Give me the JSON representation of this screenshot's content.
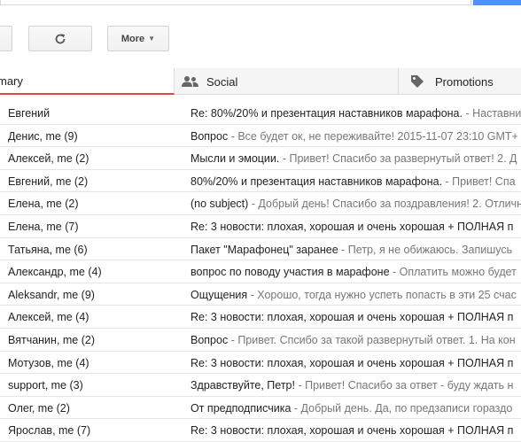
{
  "toolbar": {
    "more_label": "More",
    "caret": "▼",
    "refresh_icon": "refresh-icon"
  },
  "tabs": [
    {
      "label": "mary",
      "icon": "inbox-icon"
    },
    {
      "label": "Social",
      "icon": "people-icon"
    },
    {
      "label": "Promotions",
      "icon": "tag-icon"
    }
  ],
  "colors": {
    "primary_tab_underline": "#dd4b39",
    "search_button": "#4d90fe",
    "snippet_text": "#777777"
  },
  "emails": [
    {
      "sender": "Евгений",
      "subject": "Re: 80%/20% и презентация наставников марафона.",
      "snippet": " - Наставники марафона"
    },
    {
      "sender": "Денис, me (9)",
      "subject": "Вопрос",
      "snippet": " - Все будет ок, не переживайте! 2015-11-07 23:10 GMT+"
    },
    {
      "sender": "Алексей, me (2)",
      "subject": "Мысли и эмоции.",
      "snippet": " - Привет! Спасибо за развернутый ответ! 2. Д"
    },
    {
      "sender": "Евгений, me (2)",
      "subject": "80%/20% и презентация наставников марафона.",
      "snippet": " - Привет! Спа"
    },
    {
      "sender": "Елена, me (2)",
      "subject": "(no subject)",
      "snippet": " - Добрый день! Спасибо за поздравления! 2. Отличн"
    },
    {
      "sender": "Елена, me (7)",
      "subject": "Re: 3 новости: плохая, хорошая и очень хорошая + ПОЛНАЯ п",
      "snippet": ""
    },
    {
      "sender": "Татьяна, me (6)",
      "subject": "Пакет \"Марафонец\" заранее",
      "snippet": " - Петр, я не обижаюсь. Запишусь"
    },
    {
      "sender": "Александр, me (4)",
      "subject": "вопрос по поводу участия в марафоне",
      "snippet": " - Оплатить можно будет"
    },
    {
      "sender": "Aleksandr, me (9)",
      "subject": "Ощущения",
      "snippet": " - Хорошо, тогда нужно успеть попасть в эти 25 счас"
    },
    {
      "sender": "Алексей, me (4)",
      "subject": "Re: 3 новости: плохая, хорошая и очень хорошая + ПОЛНАЯ п",
      "snippet": ""
    },
    {
      "sender": "Вятчанин, me (2)",
      "subject": "Вопрос",
      "snippet": " - Привет. Спсибо за такой развернутый ответ. 1. На кон"
    },
    {
      "sender": "Мотузов, me (4)",
      "subject": "Re: 3 новости: плохая, хорошая и очень хорошая + ПОЛНАЯ п",
      "snippet": ""
    },
    {
      "sender": "support, me (3)",
      "subject": "Здравствуйте, Петр!",
      "snippet": " - Привет! Спасибо за ответ - буду ждать н"
    },
    {
      "sender": "Олег, me (2)",
      "subject": "От предподписчика",
      "snippet": " - Добрый день. Да, по предзаписи гораздо"
    },
    {
      "sender": "Ярослав, me (7)",
      "subject": "Re: 3 новости: плохая, хорошая и очень хорошая + ПОЛНАЯ п",
      "snippet": ""
    }
  ]
}
